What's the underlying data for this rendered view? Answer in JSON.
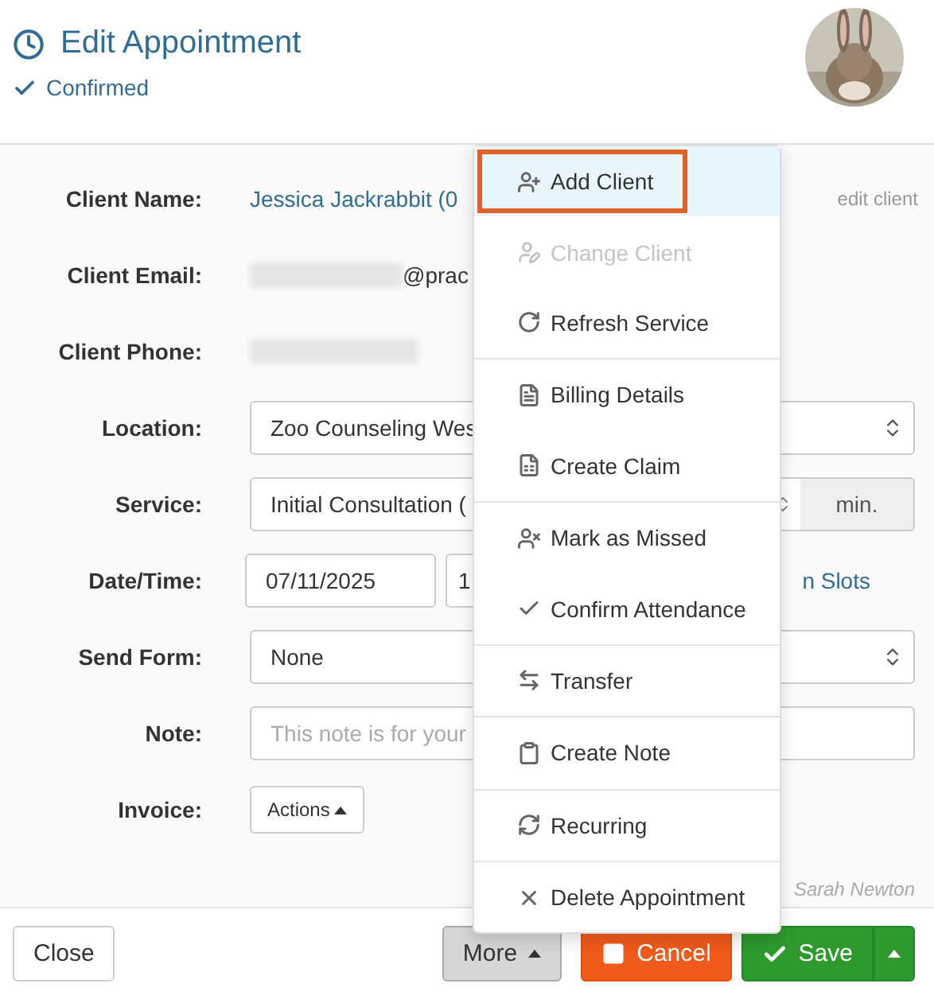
{
  "header": {
    "title": "Edit Appointment",
    "status": "Confirmed"
  },
  "form": {
    "client_name": {
      "label": "Client Name:",
      "value": "Jessica Jackrabbit (0",
      "action": "edit client"
    },
    "client_email": {
      "label": "Client Email:",
      "value": "@prac"
    },
    "client_phone": {
      "label": "Client Phone:"
    },
    "location": {
      "label": "Location:",
      "value": "Zoo Counseling Wes"
    },
    "service": {
      "label": "Service:",
      "value": "Initial Consultation (",
      "unit": "min."
    },
    "date_time": {
      "label": "Date/Time:",
      "date": "07/11/2025",
      "time": "1",
      "link": "n Slots"
    },
    "send_form": {
      "label": "Send Form:",
      "value": "None"
    },
    "note": {
      "label": "Note:",
      "placeholder": "This note is for your"
    },
    "invoice": {
      "label": "Invoice:",
      "button": "Actions"
    },
    "author": "Sarah Newton"
  },
  "menu": [
    {
      "label": "Add Client",
      "selected": true,
      "disabled": false,
      "divider_before": false
    },
    {
      "label": "Change Client",
      "selected": false,
      "disabled": true,
      "divider_before": false
    },
    {
      "label": "Refresh Service",
      "selected": false,
      "disabled": false,
      "divider_before": false
    },
    {
      "label": "Billing Details",
      "selected": false,
      "disabled": false,
      "divider_before": true
    },
    {
      "label": "Create Claim",
      "selected": false,
      "disabled": false,
      "divider_before": false
    },
    {
      "label": "Mark as Missed",
      "selected": false,
      "disabled": false,
      "divider_before": true
    },
    {
      "label": "Confirm Attendance",
      "selected": false,
      "disabled": false,
      "divider_before": false
    },
    {
      "label": "Transfer",
      "selected": false,
      "disabled": false,
      "divider_before": true
    },
    {
      "label": "Create Note",
      "selected": false,
      "disabled": false,
      "divider_before": true
    },
    {
      "label": "Recurring",
      "selected": false,
      "disabled": false,
      "divider_before": true
    },
    {
      "label": "Delete Appointment",
      "selected": false,
      "disabled": false,
      "divider_before": true
    }
  ],
  "footer": {
    "close": "Close",
    "more": "More",
    "cancel": "Cancel",
    "save": "Save"
  }
}
